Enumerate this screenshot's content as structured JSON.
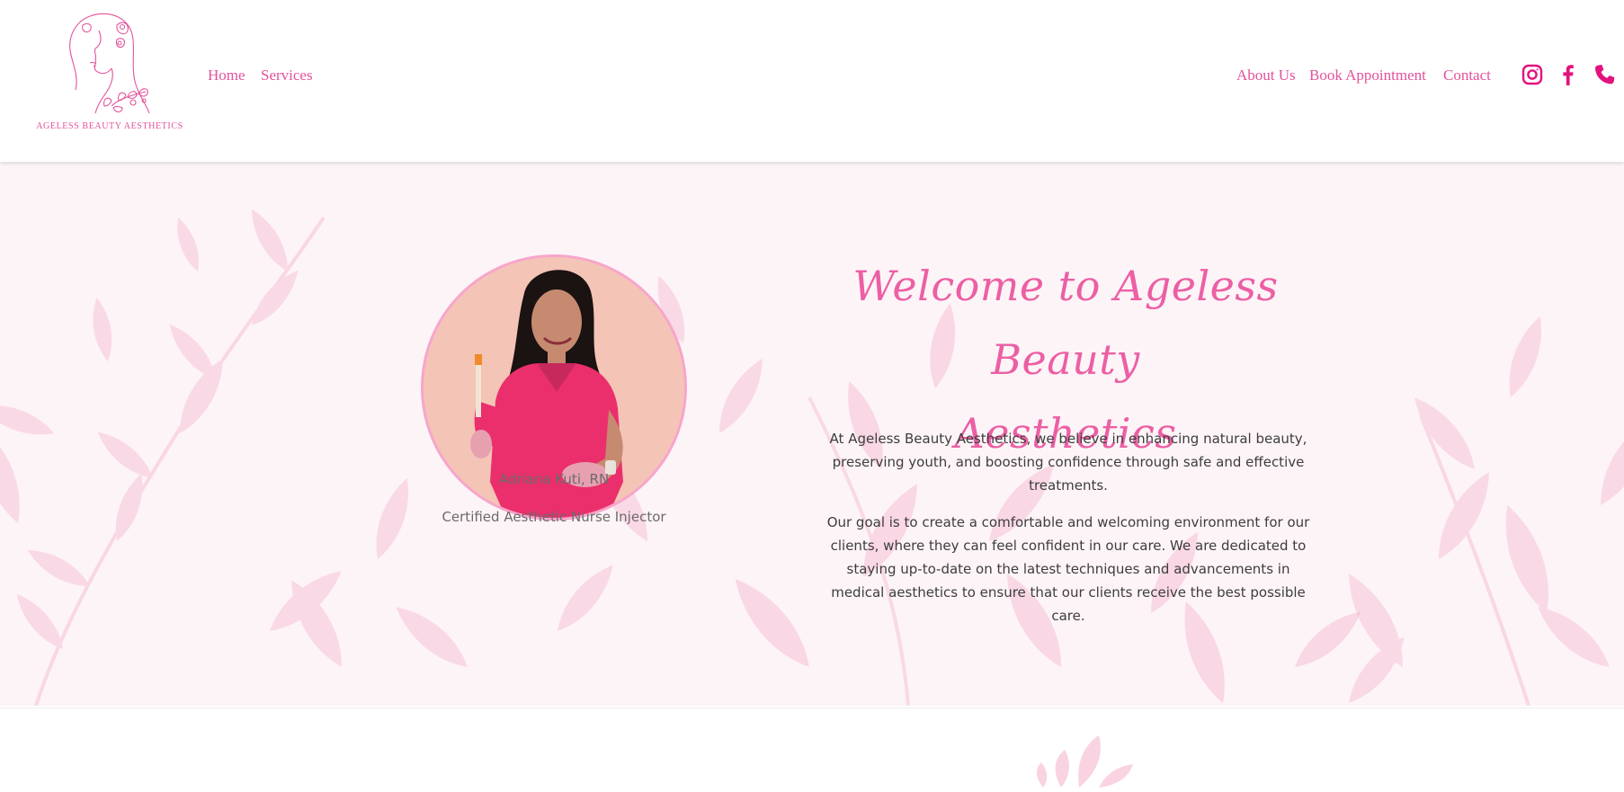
{
  "brand": {
    "name": "AGELESS BEAUTY AESTHETICS",
    "accent_color": "#e3529b",
    "logo_icon": "woman-face-floral-logo"
  },
  "nav": {
    "left": [
      "Home",
      "Services"
    ],
    "right": [
      "About Us",
      "Book Appointment",
      "Contact"
    ],
    "social_icons": [
      "instagram-icon",
      "facebook-icon",
      "phone-icon"
    ]
  },
  "hero": {
    "title_line1": "Welcome to Ageless Beauty",
    "title_line2": "Aesthetics",
    "paragraph1": "At Ageless Beauty Aesthetics, we believe in enhancing natural beauty, preserving youth, and boosting confidence through safe and effective treatments.",
    "paragraph2": "Our goal is to create a comfortable and welcoming environment for our clients, where they can feel confident in our care. We are dedicated to staying up-to-date on the latest techniques and advancements in medical aesthetics to ensure that our clients receive the best possible care.",
    "staff_name": "Adriana Kuti, RN",
    "staff_title": "Certified Aesthetic Nurse Injector",
    "background": "pink-watercolor-leaves"
  }
}
